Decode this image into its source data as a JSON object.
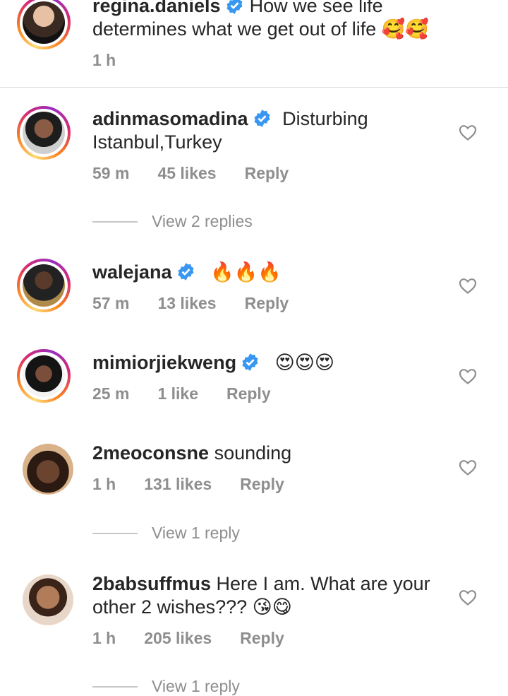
{
  "caption": {
    "username": "regina.daniels",
    "text": "How we see life determines what we get out of life",
    "time": "1 h"
  },
  "comments": [
    {
      "username": "adinmasomadina",
      "verified": true,
      "text": "Disturbing Istanbul,Turkey",
      "time": "59 m",
      "likes": "45 likes",
      "reply": "Reply",
      "view_replies": "View 2 replies"
    },
    {
      "username": "walejana",
      "verified": true,
      "text": "",
      "time": "57 m",
      "likes": "13 likes",
      "reply": "Reply"
    },
    {
      "username": "mimiorjiekweng",
      "verified": true,
      "text": "",
      "time": "25 m",
      "likes": "1 like",
      "reply": "Reply"
    },
    {
      "username": "2meoconsne",
      "verified": false,
      "text": "sounding",
      "time": "1 h",
      "likes": "131 likes",
      "reply": "Reply",
      "view_replies": "View 1 reply"
    },
    {
      "username": "2babsuffmus",
      "verified": false,
      "text": "Here I am. What are your other 2 wishes???",
      "time": "1 h",
      "likes": "205 likes",
      "reply": "Reply",
      "view_replies": "View 1 reply"
    }
  ],
  "colors": {
    "verified_blue": "#3897f0",
    "meta_gray": "#8e8e8e",
    "text": "#262626"
  },
  "icons": {
    "verified": "verified-badge-icon",
    "like": "heart-outline-icon"
  }
}
